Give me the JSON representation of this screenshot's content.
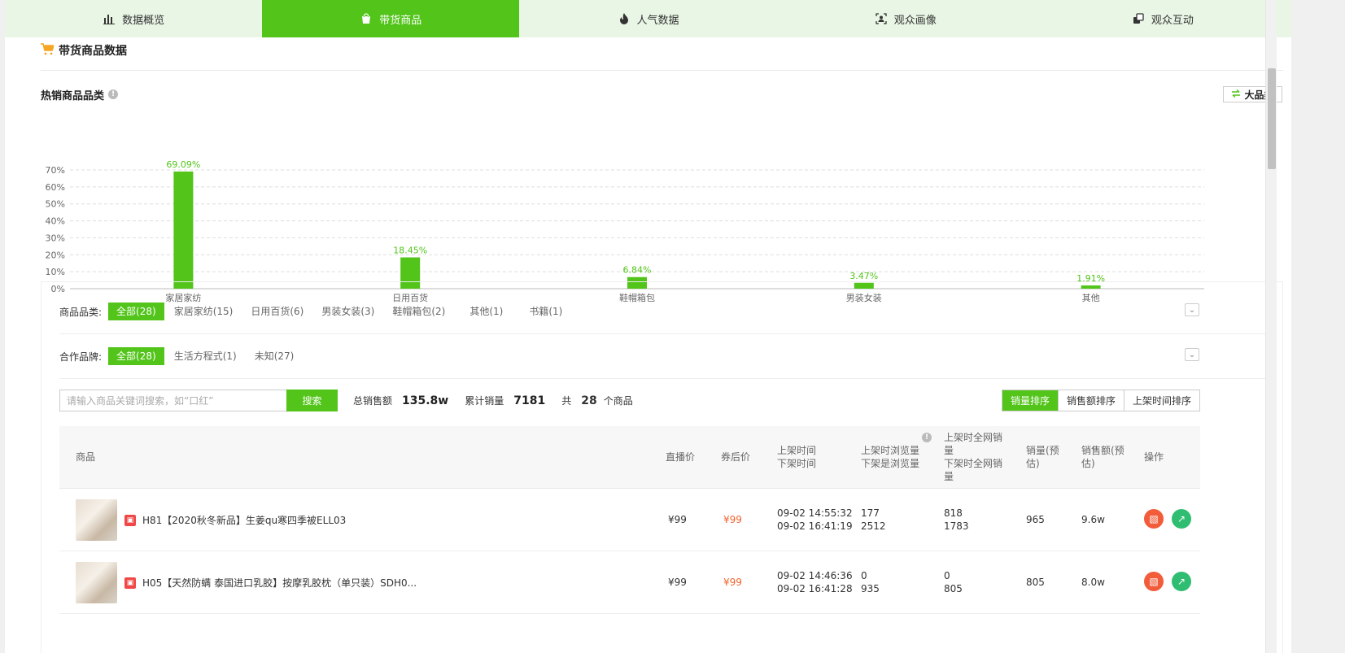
{
  "nav": [
    {
      "label": "数据概览",
      "icon": "bar-chart-icon",
      "active": false
    },
    {
      "label": "带货商品",
      "icon": "shopping-bag-icon",
      "active": true
    },
    {
      "label": "人气数据",
      "icon": "fire-icon",
      "active": false
    },
    {
      "label": "观众画像",
      "icon": "user-scan-icon",
      "active": false
    },
    {
      "label": "观众互动",
      "icon": "interaction-icon",
      "active": false
    }
  ],
  "section": {
    "title": "带货商品数据",
    "icon": "cart-icon"
  },
  "hot": {
    "title": "热销商品品类",
    "bigcat_label": "大品类"
  },
  "chart_data": {
    "type": "bar",
    "categories": [
      "家居家纺",
      "日用百货",
      "鞋帽箱包",
      "男装女装",
      "其他"
    ],
    "values": [
      69.09,
      18.45,
      6.84,
      3.47,
      1.91
    ],
    "value_labels": [
      "69.09%",
      "18.45%",
      "6.84%",
      "3.47%",
      "1.91%"
    ],
    "yticks": [
      "0%",
      "10%",
      "20%",
      "30%",
      "40%",
      "50%",
      "60%",
      "70%"
    ],
    "ylim": [
      0,
      70
    ],
    "grid": true,
    "bar_color": "#52c41a"
  },
  "filters": {
    "category": {
      "label": "商品品类:",
      "options": [
        "全部(28)",
        "家居家纺(15)",
        "日用百货(6)",
        "男装女装(3)",
        "鞋帽箱包(2)",
        "其他(1)",
        "书籍(1)"
      ]
    },
    "brand": {
      "label": "合作品牌:",
      "options": [
        "全部(28)",
        "生活方程式(1)",
        "未知(27)"
      ]
    }
  },
  "search": {
    "placeholder": "请输入商品关键词搜索，如“口红”",
    "button": "搜索"
  },
  "stats": {
    "total_sales_label": "总销售额",
    "total_sales": "135.8w",
    "total_volume_label": "累计销量",
    "total_volume": "7181",
    "count_prefix": "共",
    "count": "28",
    "count_suffix": "个商品"
  },
  "sort": [
    "销量排序",
    "销售额排序",
    "上架时间排序"
  ],
  "table": {
    "headers": {
      "product": "商品",
      "live_price": "直播价",
      "coupon_price": "券后价",
      "time1": "上架时间",
      "time2": "下架时间",
      "views1": "上架时浏览量",
      "views2": "下架是浏览量",
      "net1a": "上架时全网销",
      "net1b": "量",
      "net2a": "下架时全网销",
      "net2b": "量",
      "sales_a": "销量(预",
      "sales_b": "估)",
      "amount_a": "销售额(预",
      "amount_b": "估)",
      "op": "操作"
    },
    "rows": [
      {
        "name": "H81【2020秋冬新品】生姜qu寒四季被ELL03",
        "live_price": "¥99",
        "coupon_price": "¥99",
        "t_on": "09-02 14:55:32",
        "t_off": "09-02 16:41:19",
        "v_on": "177",
        "v_off": "2512",
        "n_on": "818",
        "n_off": "1783",
        "sales": "965",
        "amount": "9.6w"
      },
      {
        "name": "H05【天然防螨 泰国进口乳胶】按摩乳胶枕（单只装）SDH0...",
        "live_price": "¥99",
        "coupon_price": "¥99",
        "t_on": "09-02 14:46:36",
        "t_off": "09-02 16:41:28",
        "v_on": "0",
        "v_off": "935",
        "n_on": "0",
        "n_off": "805",
        "sales": "805",
        "amount": "8.0w"
      }
    ]
  }
}
